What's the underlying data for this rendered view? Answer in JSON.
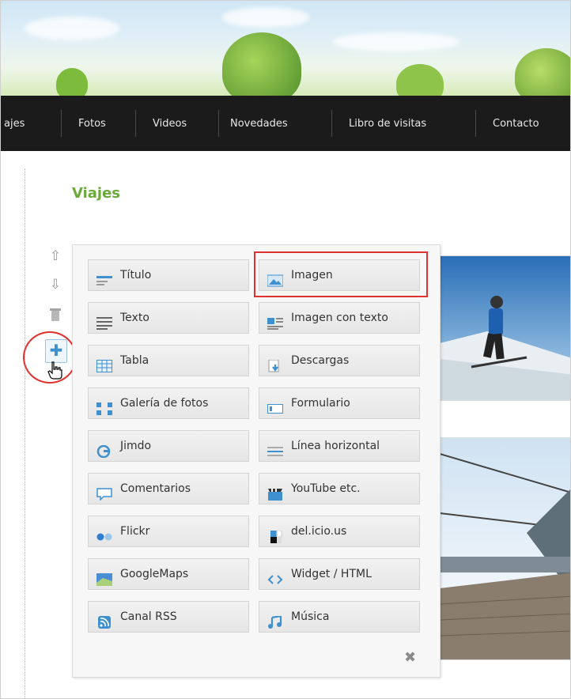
{
  "nav": {
    "items": [
      "ajes",
      "Fotos",
      "Videos",
      "Novedades",
      "Libro de visitas",
      "Contacto"
    ]
  },
  "page": {
    "heading": "Viajes"
  },
  "panel": {
    "left_column": [
      {
        "label": "Título",
        "icon": "title-icon"
      },
      {
        "label": "Texto",
        "icon": "text-icon"
      },
      {
        "label": "Tabla",
        "icon": "table-icon"
      },
      {
        "label": "Galería de fotos",
        "icon": "photo-gallery-icon"
      },
      {
        "label": "Jimdo",
        "icon": "jimdo-icon"
      },
      {
        "label": "Comentarios",
        "icon": "comments-icon"
      },
      {
        "label": "Flickr",
        "icon": "flickr-icon"
      },
      {
        "label": "GoogleMaps",
        "icon": "googlemaps-icon"
      },
      {
        "label": "Canal RSS",
        "icon": "rss-icon"
      }
    ],
    "right_column": [
      {
        "label": "Imagen",
        "icon": "image-icon"
      },
      {
        "label": "Imagen con texto",
        "icon": "image-with-text-icon"
      },
      {
        "label": "Descargas",
        "icon": "downloads-icon"
      },
      {
        "label": "Formulario",
        "icon": "form-icon"
      },
      {
        "label": "Línea horizontal",
        "icon": "horizontal-line-icon"
      },
      {
        "label": "YouTube etc.",
        "icon": "youtube-icon"
      },
      {
        "label": "del.icio.us",
        "icon": "delicious-icon"
      },
      {
        "label": "Widget / HTML",
        "icon": "widget-html-icon"
      },
      {
        "label": "Música",
        "icon": "music-icon"
      }
    ],
    "highlighted_item": "Imagen"
  },
  "colors": {
    "nav_bg": "#1b1b1b",
    "heading_green": "#6aaa3a",
    "annotation_red": "#e03131",
    "icon_blue": "#3f90cf"
  }
}
